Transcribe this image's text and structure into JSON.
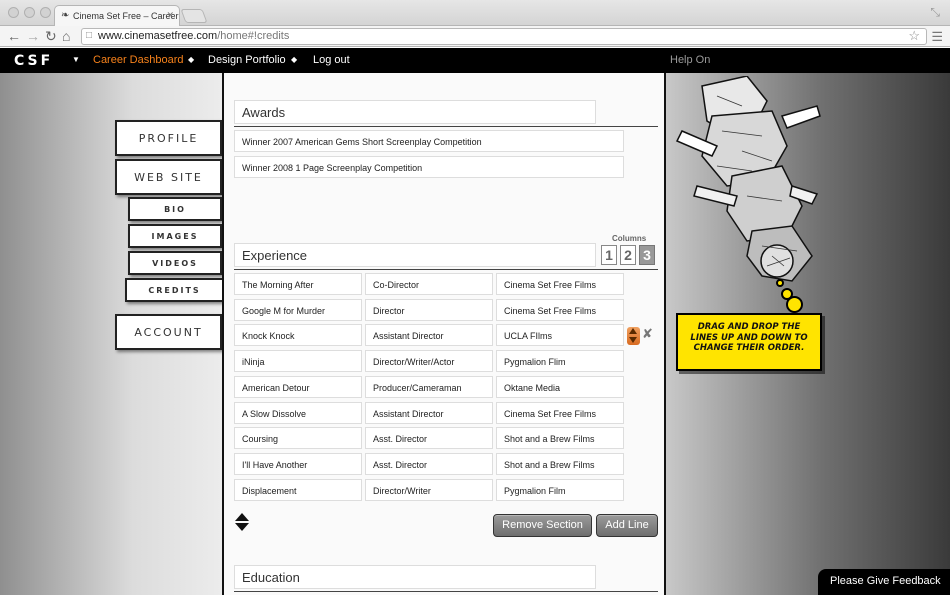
{
  "browser": {
    "tab_title": "Cinema Set Free – Career C",
    "url_host": "www.cinemasetfree.com",
    "url_path": "/home#!credits"
  },
  "nav": {
    "logo": "CSF",
    "links": [
      "Career Dashboard",
      "Design Portfolio",
      "Log out"
    ],
    "help": "Help On"
  },
  "sidebar": {
    "profile": "Profile",
    "website": "Web Site",
    "sub": [
      "Bio",
      "Images",
      "Videos",
      "Credits"
    ],
    "account": "Account"
  },
  "awards": {
    "title": "Awards",
    "items": [
      "Winner 2007 American Gems Short Screenplay Competition",
      "Winner 2008 1 Page Screenplay Competition"
    ]
  },
  "experience": {
    "title": "Experience",
    "columns_label": "Columns",
    "column_options": [
      "1",
      "2",
      "3"
    ],
    "rows": [
      [
        "The Morning After",
        "Co-Director",
        "Cinema Set Free Films"
      ],
      [
        "Google M for Murder",
        "Director",
        "Cinema Set Free Films"
      ],
      [
        "Knock Knock",
        "Assistant Director",
        "UCLA FIlms"
      ],
      [
        "iNinja",
        "Director/Writer/Actor",
        "Pygmalion Flim"
      ],
      [
        "American Detour",
        "Producer/Cameraman",
        "Oktane Media"
      ],
      [
        "A Slow Dissolve",
        "Assistant Director",
        "Cinema Set Free Films"
      ],
      [
        "Coursing",
        "Asst. Director",
        "Shot and a Brew Films"
      ],
      [
        "I'll Have Another",
        "Asst. Director",
        "Shot and a Brew Films"
      ],
      [
        "Displacement",
        "Director/Writer",
        "Pygmalion Film"
      ]
    ],
    "remove_label": "Remove Section",
    "add_label": "Add Line"
  },
  "education": {
    "title": "Education"
  },
  "tip": "Drag and drop the lines up and down to change their order.",
  "feedback": "Please Give Feedback"
}
